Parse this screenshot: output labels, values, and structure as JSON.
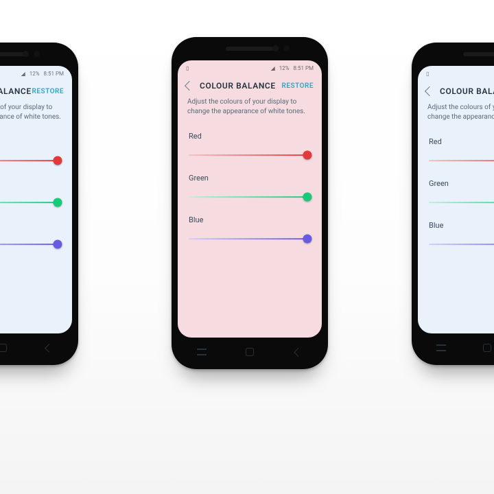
{
  "statusbar": {
    "battery": "12%",
    "time": "8:51 PM"
  },
  "header": {
    "title": "COLOUR BALANCE",
    "restore": "RESTORE"
  },
  "description": "Adjust the colours of your display to change the appearance of white tones.",
  "sliders": [
    {
      "label": "Red",
      "color": "#e03a3a",
      "value_pct": 97,
      "track_style": "background:linear-gradient(90deg,#f5c1c1,#e03a3a)",
      "thumb_style": "left:97%;background:#e03a3a"
    },
    {
      "label": "Green",
      "color": "#18c977",
      "value_pct": 97,
      "track_style": "background:linear-gradient(90deg,#bff0d8,#18c977)",
      "thumb_style": "left:97%;background:#18c977"
    },
    {
      "label": "Blue",
      "color": "#6a5ae0",
      "value_pct": 97,
      "track_style": "background:linear-gradient(90deg,#d3cff6,#6a5ae0)",
      "thumb_style": "left:97%;background:#6a5ae0"
    }
  ],
  "phones": [
    {
      "position": "left",
      "screen_tint": "#e9f2fb"
    },
    {
      "position": "center",
      "screen_tint": "#f6dce0"
    },
    {
      "position": "right",
      "screen_tint": "#e9f2fb"
    }
  ]
}
